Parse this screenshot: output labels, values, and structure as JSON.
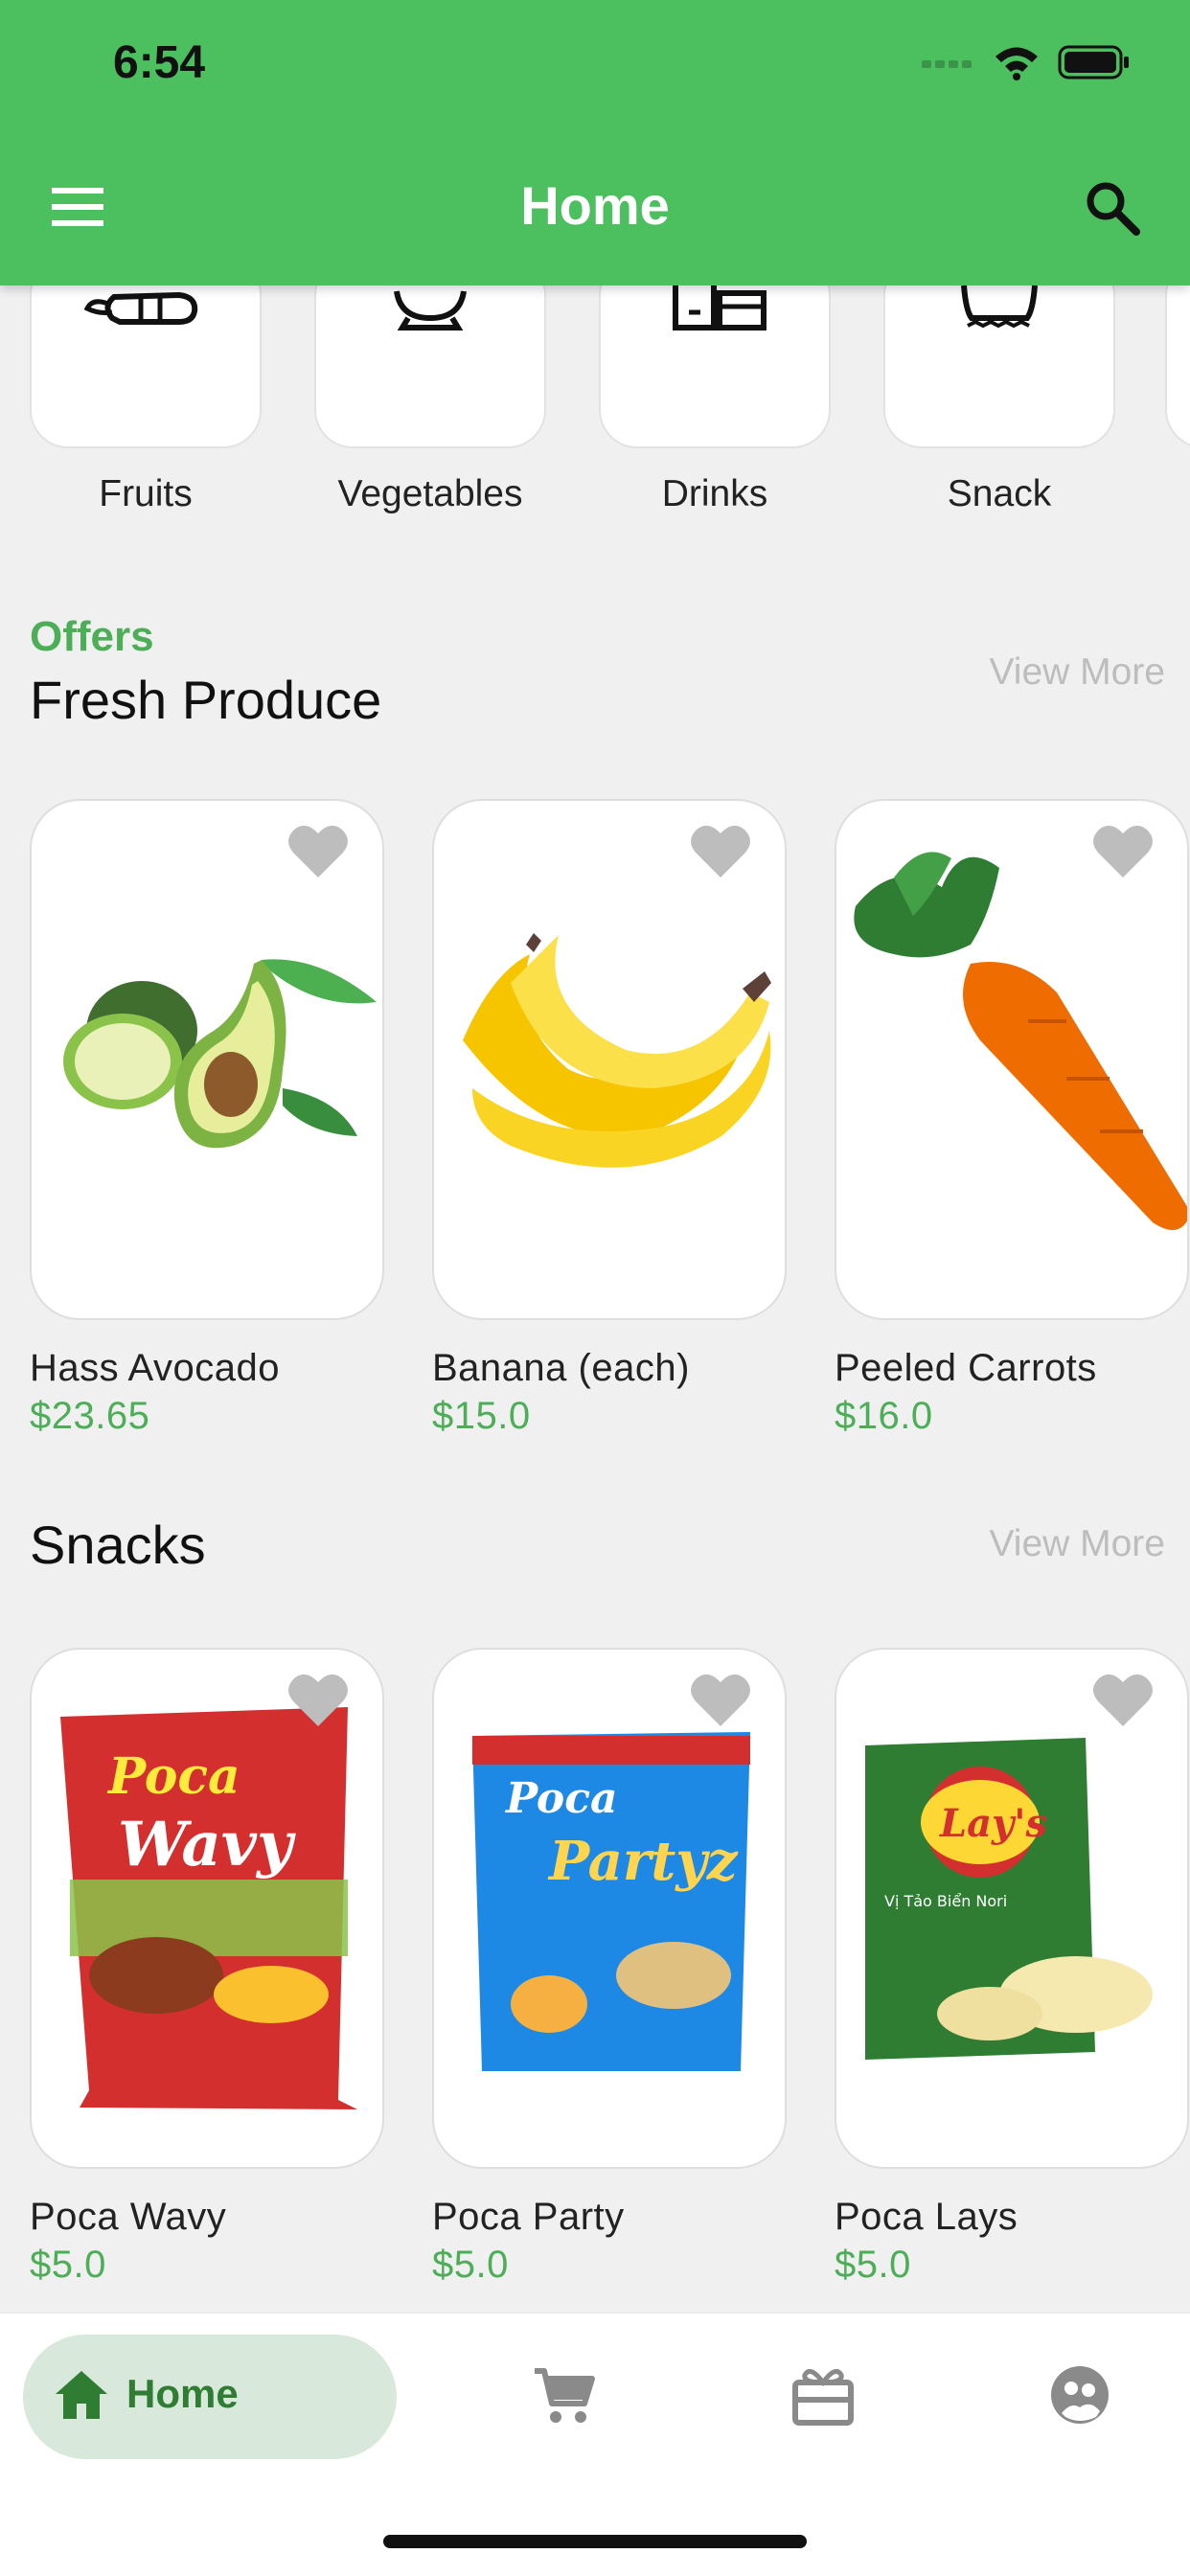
{
  "status_bar": {
    "time": "6:54"
  },
  "app_bar": {
    "title": "Home"
  },
  "categories": [
    {
      "label": "Fruits",
      "icon": "carrot-outline-icon"
    },
    {
      "label": "Vegetables",
      "icon": "bowl-outline-icon"
    },
    {
      "label": "Drinks",
      "icon": "drinks-outline-icon"
    },
    {
      "label": "Snack",
      "icon": "snack-outline-icon"
    }
  ],
  "offers_section": {
    "subtitle": "Offers",
    "title": "Fresh Produce",
    "view_more": "View More",
    "products": [
      {
        "name": "Hass Avocado",
        "price": "$23.65",
        "image": "avocado"
      },
      {
        "name": "Banana (each)",
        "price": "$15.0",
        "image": "banana"
      },
      {
        "name": "Peeled Carrots",
        "price": "$16.0",
        "image": "carrot"
      }
    ]
  },
  "snacks_section": {
    "title": "Snacks",
    "view_more": "View More",
    "products": [
      {
        "name": "Poca Wavy",
        "price": "$5.0",
        "image": "poca-wavy-bag",
        "bag_brand": "Poca",
        "bag_text": "Wavy"
      },
      {
        "name": "Poca Party",
        "price": "$5.0",
        "image": "poca-party-bag",
        "bag_brand": "Poca",
        "bag_text": "Partyz"
      },
      {
        "name": "Poca Lays",
        "price": "$5.0",
        "image": "lays-bag",
        "bag_brand": "Lay's",
        "bag_text": "Vị Tảo Biển Nori"
      }
    ]
  },
  "bottom_nav": {
    "items": [
      {
        "label": "Home",
        "icon": "home-icon",
        "active": true
      },
      {
        "label": "",
        "icon": "cart-icon"
      },
      {
        "label": "",
        "icon": "gift-box-icon"
      },
      {
        "label": "",
        "icon": "profile-icon"
      }
    ]
  },
  "colors": {
    "primary": "#4cbf5f",
    "price": "#4cae57",
    "active_pill": "#d8e8da",
    "active_text": "#2e7d32"
  }
}
